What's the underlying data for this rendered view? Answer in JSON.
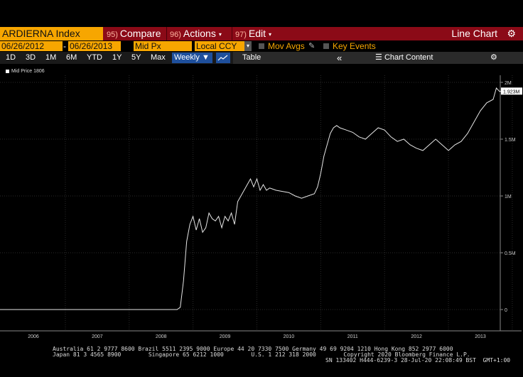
{
  "toolbar": {
    "ticker": "ARDIERNA Index",
    "compare": {
      "num": "95)",
      "label": "Compare"
    },
    "actions": {
      "num": "96)",
      "label": "Actions"
    },
    "edit": {
      "num": "97)",
      "label": "Edit"
    },
    "chart_type": "Line Chart",
    "caret": "▾",
    "gear_icon": "⚙"
  },
  "settings": {
    "start_date": "06/26/2012",
    "end_date": "06/26/2013",
    "dash": "-",
    "field": "Mid Px",
    "currency": "Local CCY",
    "mov_avgs": "Mov Avgs",
    "key_events": "Key Events"
  },
  "periods": [
    "1D",
    "3D",
    "1M",
    "6M",
    "YTD",
    "1Y",
    "5Y",
    "Max"
  ],
  "frequency": "Weekly",
  "table_label": "Table",
  "collapse_icon": "«",
  "chart_content_label": "Chart Content",
  "legend": {
    "label": "Mid Price 1806"
  },
  "last_value_tag": "1.923M",
  "chart_data": {
    "type": "line",
    "series": [
      {
        "name": "Mid Price 1806",
        "x": [
          2005.0,
          2006.0,
          2007.0,
          2007.5,
          2008.0,
          2008.15,
          2008.25,
          2008.3,
          2008.35,
          2008.4,
          2008.45,
          2008.5,
          2008.55,
          2008.6,
          2008.65,
          2008.7,
          2008.75,
          2008.8,
          2008.85,
          2008.9,
          2008.95,
          2009.0,
          2009.05,
          2009.1,
          2009.15,
          2009.2,
          2009.3,
          2009.35,
          2009.4,
          2009.45,
          2009.5,
          2009.55,
          2009.6,
          2009.65,
          2009.7,
          2009.8,
          2009.9,
          2010.0,
          2010.1,
          2010.2,
          2010.3,
          2010.4,
          2010.45,
          2010.5,
          2010.55,
          2010.6,
          2010.65,
          2010.7,
          2010.75,
          2010.8,
          2010.9,
          2011.0,
          2011.1,
          2011.2,
          2011.3,
          2011.4,
          2011.5,
          2011.6,
          2011.7,
          2011.8,
          2011.9,
          2012.0,
          2012.1,
          2012.2,
          2012.3,
          2012.4,
          2012.5,
          2012.6,
          2012.7,
          2012.8,
          2012.9,
          2013.0,
          2013.1,
          2013.2,
          2013.25,
          2013.3,
          2013.35
        ],
        "y": [
          0,
          0,
          0,
          0,
          0,
          0,
          0,
          0.02,
          0.25,
          0.6,
          0.75,
          0.82,
          0.7,
          0.8,
          0.68,
          0.72,
          0.85,
          0.8,
          0.78,
          0.82,
          0.72,
          0.82,
          0.78,
          0.85,
          0.75,
          0.95,
          1.05,
          1.1,
          1.15,
          1.08,
          1.15,
          1.05,
          1.1,
          1.05,
          1.07,
          1.05,
          1.04,
          1.03,
          1.0,
          0.98,
          1.0,
          1.02,
          1.08,
          1.2,
          1.35,
          1.45,
          1.55,
          1.6,
          1.62,
          1.6,
          1.58,
          1.56,
          1.52,
          1.5,
          1.55,
          1.6,
          1.58,
          1.52,
          1.48,
          1.5,
          1.45,
          1.42,
          1.4,
          1.45,
          1.5,
          1.45,
          1.4,
          1.45,
          1.48,
          1.55,
          1.65,
          1.75,
          1.82,
          1.85,
          1.95,
          1.92,
          1.923
        ]
      }
    ],
    "xticks": [
      "2006",
      "2007",
      "2008",
      "2009",
      "2010",
      "2011",
      "2012",
      "2013"
    ],
    "yticks": [
      "0",
      "0.5M",
      "1M",
      "1.5M",
      "2M"
    ],
    "xlim": [
      2005.5,
      2013.5
    ],
    "ylim": [
      0,
      2.0
    ]
  },
  "footer": {
    "line1": "Australia 61 2 9777 8600 Brazil 5511 2395 9000 Europe 44 20 7330 7500 Germany 49 69 9204 1210 Hong Kong 852 2977 6000",
    "line2": "Japan 81 3 4565 8900        Singapore 65 6212 1000        U.S. 1 212 318 2000        Copyright 2020 Bloomberg Finance L.P.",
    "line3": "SN 133402 H444-6239-3 28-Jul-20 22:08:49 BST  GMT+1:00"
  },
  "colors": {
    "ticker_bg": "#f7a600",
    "bar_bg": "#8b0a17",
    "line": "#ffffff",
    "highlight": "#1e4f9c"
  }
}
